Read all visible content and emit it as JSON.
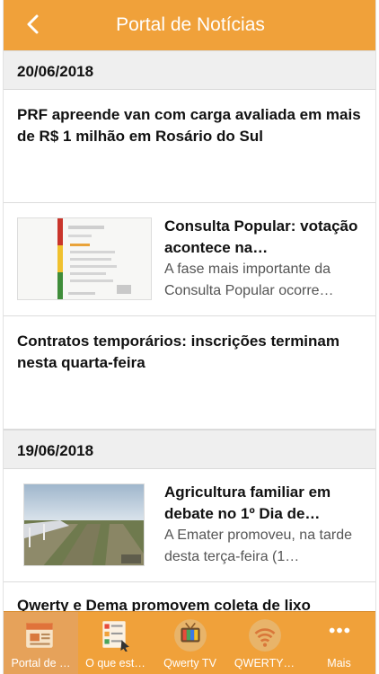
{
  "navbar": {
    "back_icon": "chevron-left-icon",
    "back_glyph": "‹",
    "title": "Portal de Notícias"
  },
  "sections": [
    {
      "date": "20/06/2018",
      "items": [
        {
          "title": "PRF apreende van com carga avaliada em mais de R$ 1 milhão em Rosário do Sul"
        },
        {
          "title": "Consulta Popular: votação acontece na…",
          "summary": "A fase mais importante da Consulta Popular ocorre…"
        },
        {
          "title": "Contratos temporários: inscrições terminam nesta quarta-feira"
        }
      ]
    },
    {
      "date": "19/06/2018",
      "items": [
        {
          "title": "Agricultura familiar em debate no 1º Dia de…",
          "summary": "A Emater promoveu, na tarde desta terça-feira (1…"
        },
        {
          "title": "Qwerty e Dema promovem coleta de lixo"
        }
      ]
    }
  ],
  "thumb_watermark": "QWERTY",
  "tabs": [
    {
      "label": "Portal de …",
      "icon": "newspaper-icon",
      "badge": "NEWS",
      "active": true
    },
    {
      "label": "O que est…",
      "icon": "checklist-icon",
      "active": false
    },
    {
      "label": "Qwerty TV",
      "icon": "tv-icon",
      "active": false
    },
    {
      "label": "QWERTY…",
      "icon": "radio-wave-icon",
      "active": false
    },
    {
      "label": "Mais",
      "icon": "more-dots-icon",
      "active": false
    }
  ],
  "colors": {
    "accent": "#f0a13a",
    "section_bg": "#efefef",
    "text": "#111111",
    "subtext": "#555555"
  }
}
